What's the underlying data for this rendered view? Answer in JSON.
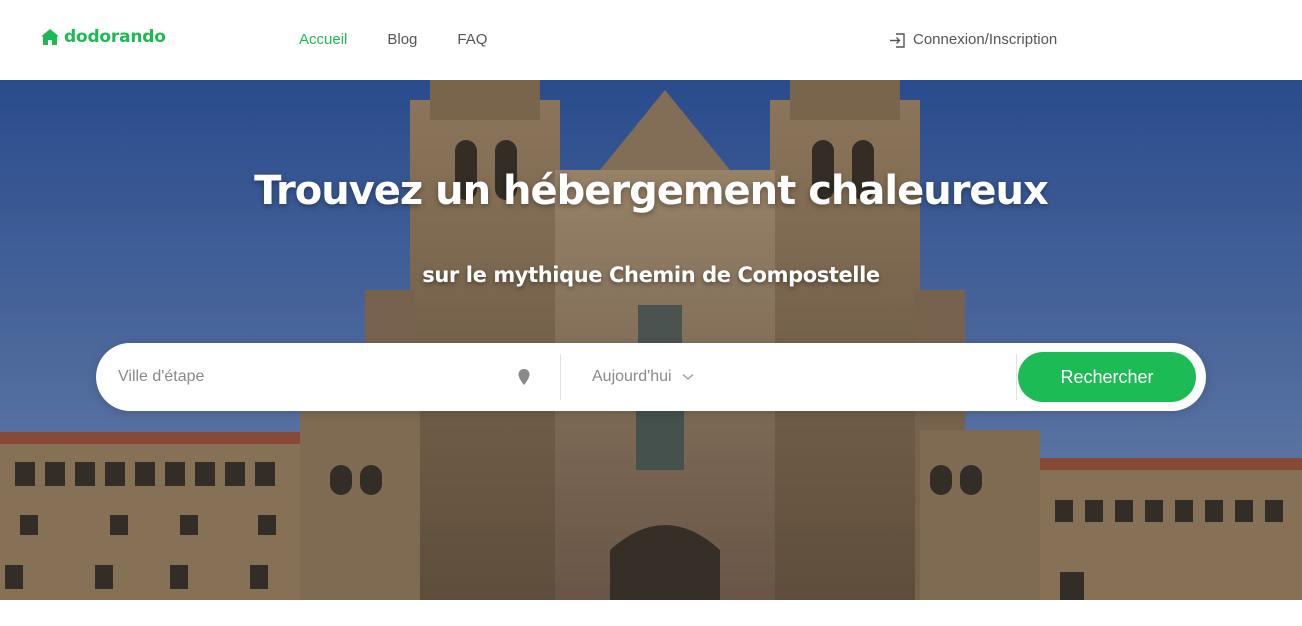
{
  "brand": {
    "name": "dodorando",
    "color": "#1db954"
  },
  "nav": {
    "items": [
      {
        "label": "Accueil",
        "active": true
      },
      {
        "label": "Blog",
        "active": false
      },
      {
        "label": "FAQ",
        "active": false
      }
    ]
  },
  "header": {
    "login_label": "Connexion/Inscription",
    "login_icon": "login-icon"
  },
  "hero": {
    "title": "Trouvez un hébergement chaleureux",
    "subtitle": "sur le mythique Chemin de Compostelle",
    "background_image": "cathedral-photo"
  },
  "search": {
    "city_placeholder": "Ville d'étape",
    "city_value": "",
    "location_icon": "map-pin-icon",
    "date_value": "Aujourd'hui",
    "date_icon": "chevron-down-icon",
    "submit_label": "Rechercher",
    "submit_color": "#1cbb55"
  }
}
